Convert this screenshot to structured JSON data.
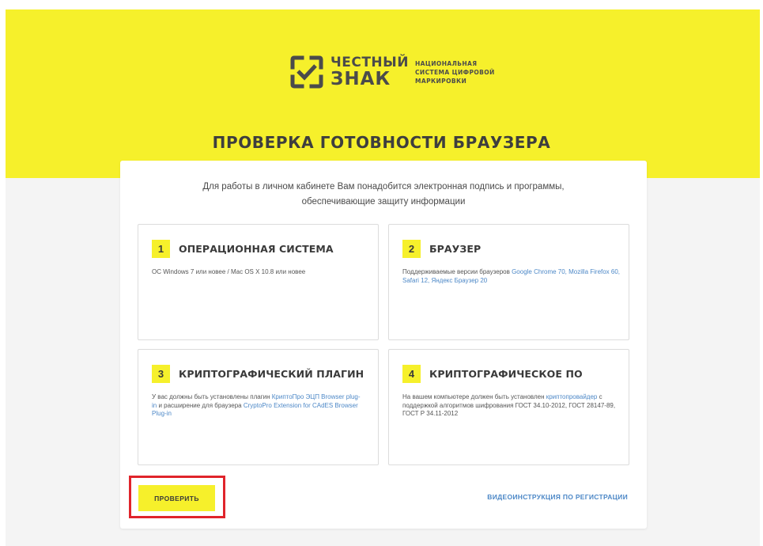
{
  "brand": {
    "logo_line1": "ЧЕСТНЫЙ",
    "logo_line2": "ЗНАК",
    "tagline": [
      "НАЦИОНАЛЬНАЯ",
      "СИСТЕМА ЦИФРОВОЙ",
      "МАРКИРОВКИ"
    ]
  },
  "page_title": "ПРОВЕРКА ГОТОВНОСТИ БРАУЗЕРА",
  "intro": {
    "line1": "Для работы в личном кабинете Вам понадобится электронная подпись и программы,",
    "line2": "обеспечивающие защиту информации"
  },
  "requirements": [
    {
      "num": "1",
      "title": "ОПЕРАЦИОННАЯ СИСТЕМА",
      "text": "ОС Windows 7 или новее / Mac OS X 10.8 или новее"
    },
    {
      "num": "2",
      "title": "БРАУЗЕР",
      "text_before": "Поддерживаемые версии браузеров ",
      "link": "Google Chrome 70, Mozilla Firefox 60, Safari 12, Яндекс Браузер 20"
    },
    {
      "num": "3",
      "title": "КРИПТОГРАФИЧЕСКИЙ ПЛАГИН",
      "text_before": "У вас должны быть установлены плагин ",
      "link1": "КриптоПро ЭЦП Browser plug-in",
      "text_middle": " и расширение для браузера ",
      "link2": "CryptoPro Extension for CAdES Browser Plug-in"
    },
    {
      "num": "4",
      "title": "КРИПТОГРАФИЧЕСКОЕ ПО",
      "text_before": "На вашем компьютере должен быть установлен ",
      "link": "криптопровайдер",
      "text_after": " с поддержкой алгоритмов шифрования ГОСТ 34.10-2012, ГОСТ 28147-89, ГОСТ Р 34.11-2012"
    }
  ],
  "actions": {
    "check_label": "ПРОВЕРИТЬ",
    "video_label": "ВИДЕОИНСТРУКЦИЯ ПО РЕГИСТРАЦИИ"
  },
  "colors": {
    "brand_yellow": "#f6f02b",
    "link_blue": "#4d88c7",
    "highlight_red": "#e0242b"
  }
}
